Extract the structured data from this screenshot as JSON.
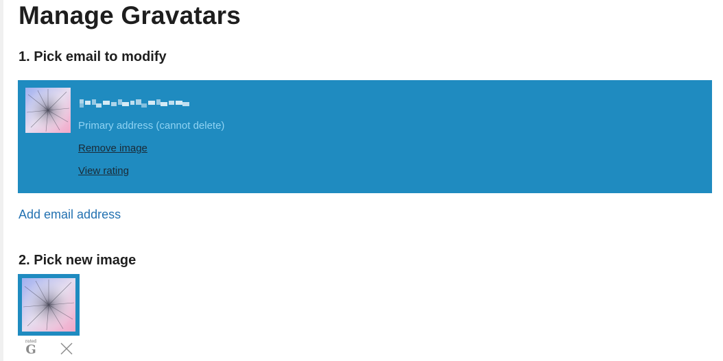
{
  "page": {
    "title": "Manage Gravatars"
  },
  "step1": {
    "title": "1. Pick email to modify",
    "email": {
      "primary_note": "Primary address (cannot delete)",
      "remove_image_label": "Remove image",
      "view_rating_label": "View rating"
    },
    "add_email_label": "Add email address"
  },
  "step2": {
    "title": "2. Pick new image",
    "images": [
      {
        "rating_small": "rated",
        "rating_letter": "G",
        "delete_icon": "close-icon"
      }
    ]
  },
  "colors": {
    "panel_bg": "#1f8bc0",
    "link": "#2271b1",
    "primary_note": "#8fd3f3"
  }
}
